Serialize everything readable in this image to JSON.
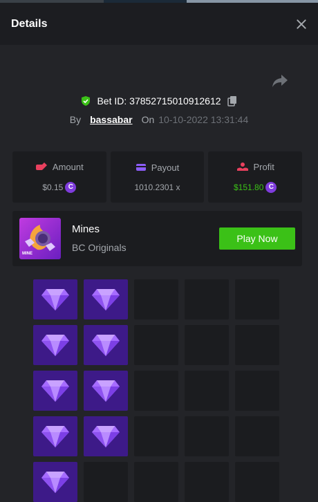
{
  "header": {
    "title": "Details"
  },
  "bet": {
    "id_label": "Bet ID:",
    "id": "37852715010912612",
    "by_label": "By",
    "username": "bassabar",
    "on_label": "On",
    "date": "10-10-2022 13:31:44"
  },
  "stats": [
    {
      "label": "Amount",
      "value": "$0.15",
      "icon": "hand-coins-icon",
      "coin": "C"
    },
    {
      "label": "Payout",
      "value": "1010.2301 x",
      "icon": "wallet-icon"
    },
    {
      "label": "Profit",
      "value": "$151.80",
      "icon": "hand-profit-icon",
      "coin": "C"
    }
  ],
  "game": {
    "name": "Mines",
    "provider": "BC Originals",
    "thumb_label": "MINE",
    "play_label": "Play Now"
  },
  "board": {
    "columns": 5,
    "tiles": [
      "gem",
      "gem",
      "hidden",
      "hidden",
      "hidden",
      "gem",
      "gem",
      "hidden",
      "hidden",
      "hidden",
      "gem",
      "gem",
      "hidden",
      "hidden",
      "hidden",
      "gem",
      "gem",
      "hidden",
      "hidden",
      "hidden",
      "gem",
      "hidden",
      "hidden",
      "hidden",
      "hidden"
    ]
  },
  "colors": {
    "accent_green": "#3bc117",
    "coin_purple": "#7f3cdd",
    "gem_tile": "#3d1a88",
    "panel": "#1b1c1f"
  }
}
